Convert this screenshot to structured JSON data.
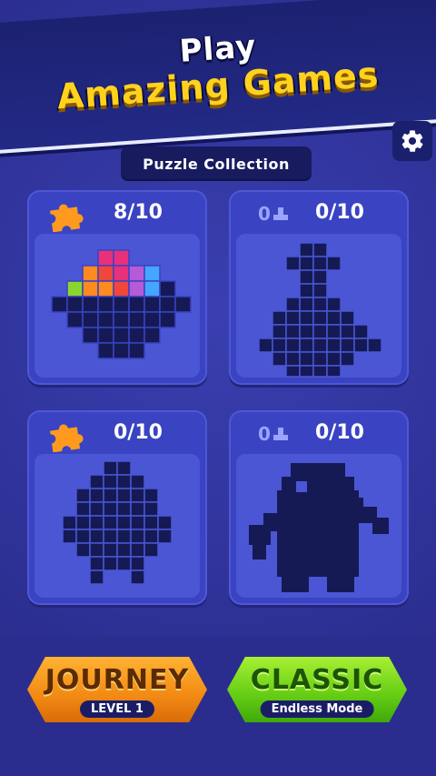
{
  "banner": {
    "title_top": "Play",
    "title_bottom": "Amazing Games"
  },
  "settings": {
    "icon": "gear-icon"
  },
  "collection_label": "Puzzle Collection",
  "cards": [
    {
      "progress": "8/10",
      "status": "unlocked",
      "icon": "puzzle-piece-icon"
    },
    {
      "progress": "0/10",
      "status": "locked",
      "locked_count": "0",
      "icon": "block-piece-icon"
    },
    {
      "progress": "0/10",
      "status": "unlocked",
      "icon": "puzzle-piece-icon"
    },
    {
      "progress": "0/10",
      "status": "locked",
      "locked_count": "0",
      "icon": "block-piece-icon"
    }
  ],
  "buttons": {
    "journey": {
      "label": "JOURNEY",
      "sub": "LEVEL 1"
    },
    "classic": {
      "label": "CLASSIC",
      "sub": "Endless Mode"
    }
  },
  "colors": {
    "background": "#2e3196",
    "banner_yellow": "#ffd21e",
    "journey_orange": "#f28a14",
    "classic_green": "#64cc14",
    "silhouette": "#151a55"
  }
}
